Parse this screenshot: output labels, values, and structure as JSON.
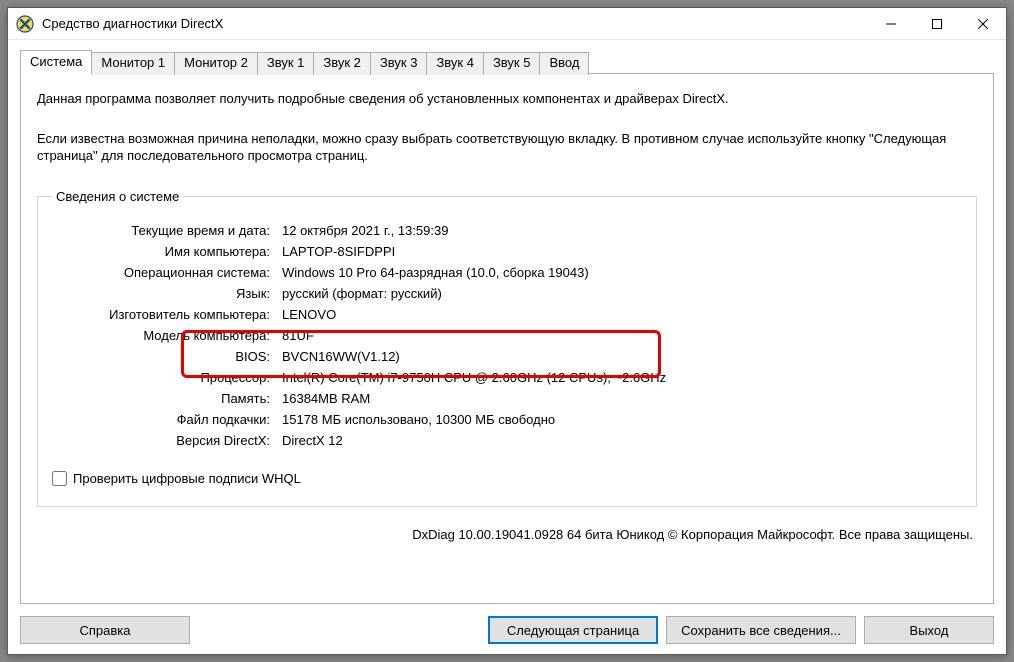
{
  "window": {
    "title": "Средство диагностики DirectX"
  },
  "tabs": [
    "Система",
    "Монитор 1",
    "Монитор 2",
    "Звук 1",
    "Звук 2",
    "Звук 3",
    "Звук 4",
    "Звук 5",
    "Ввод"
  ],
  "intro": {
    "p1": "Данная программа позволяет получить подробные сведения об установленных компонентах и драйверах DirectX.",
    "p2": "Если известна возможная причина неполадки, можно сразу выбрать соответствующую вкладку. В противном случае используйте кнопку \"Следующая страница\" для последовательного просмотра страниц."
  },
  "sysinfo": {
    "legend": "Сведения о системе",
    "rows": [
      {
        "label": "Текущие время и дата:",
        "value": "12 октября 2021 г., 13:59:39"
      },
      {
        "label": "Имя компьютера:",
        "value": "LAPTOP-8SIFDPPI"
      },
      {
        "label": "Операционная система:",
        "value": "Windows 10 Pro 64-разрядная (10.0, сборка 19043)"
      },
      {
        "label": "Язык:",
        "value": "русский (формат: русский)"
      },
      {
        "label": "Изготовитель компьютера:",
        "value": "LENOVO"
      },
      {
        "label": "Модель компьютера:",
        "value": "81UF"
      },
      {
        "label": "BIOS:",
        "value": "BVCN16WW(V1.12)"
      },
      {
        "label": "Процессор:",
        "value": "Intel(R) Core(TM) i7-9750H CPU @ 2.60GHz (12 CPUs), ~2.6GHz"
      },
      {
        "label": "Память:",
        "value": "16384MB RAM"
      },
      {
        "label": "Файл подкачки:",
        "value": "15178 МБ использовано, 10300 МБ свободно"
      },
      {
        "label": "Версия DirectX:",
        "value": "DirectX 12"
      }
    ],
    "checkbox_label": "Проверить цифровые подписи WHQL"
  },
  "footer": "DxDiag 10.00.19041.0928 64 бита Юникод © Корпорация Майкрософт. Все права защищены.",
  "buttons": {
    "help": "Справка",
    "next": "Следующая страница",
    "save": "Сохранить все сведения...",
    "exit": "Выход"
  }
}
